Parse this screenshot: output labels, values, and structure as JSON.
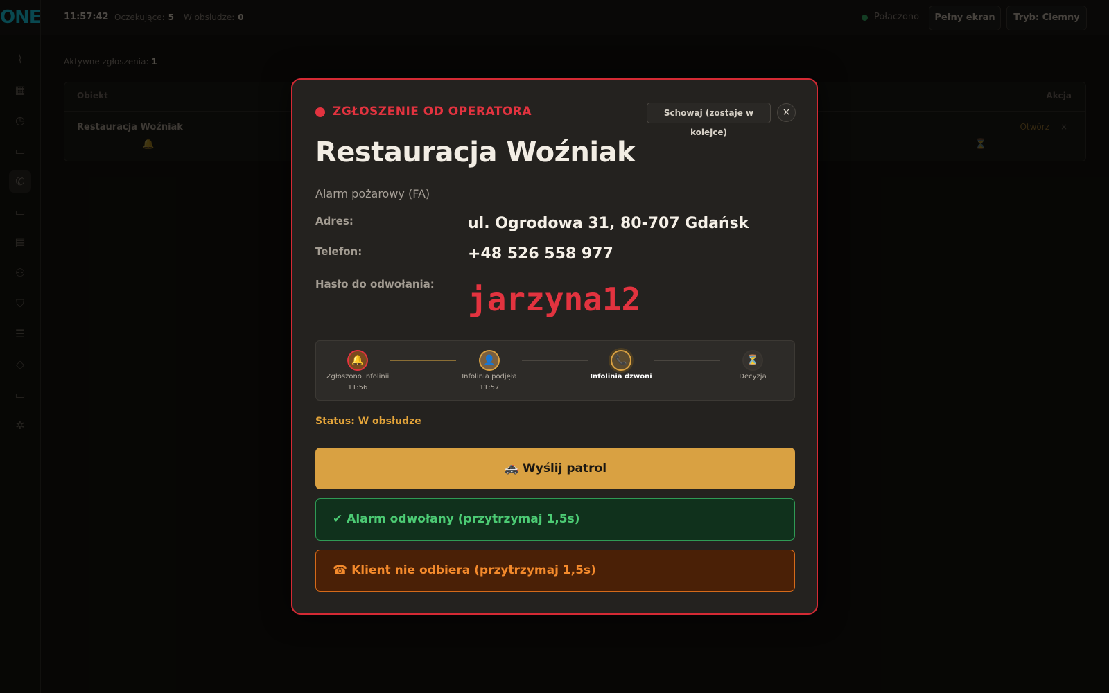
{
  "app": {
    "logo": "ONE"
  },
  "topbar": {
    "clock": "11:57:42",
    "waiting_label": "Oczekujące:",
    "waiting_count": "5",
    "in_service_label": "W obsłudze:",
    "in_service_count": "0",
    "connection": "Połączono",
    "fullscreen_button": "Pełny ekran",
    "theme_button": "Tryb: Ciemny"
  },
  "main": {
    "active_label": "Aktywne zgłoszenia:",
    "active_count": "1",
    "table": {
      "headers": {
        "object": "Obiekt",
        "action": "Akcja"
      },
      "row": {
        "name": "Restauracja Woźniak",
        "open": "Otwórz",
        "close": "×"
      }
    }
  },
  "modal": {
    "header": "ZGŁOSZENIE OD OPERATORA",
    "hide_button": "Schowaj (zostaje w kolejce)",
    "close_button": "×",
    "object_name": "Restauracja Woźniak",
    "alarm_type": "Alarm pożarowy (FA)",
    "address_label": "Adres:",
    "address": "ul. Ogrodowa 31, 80-707 Gdańsk",
    "phone_label": "Telefon:",
    "phone": "+48 526 558 977",
    "password_label": "Hasło do odwołania:",
    "password": "jarzyna12",
    "steps": [
      {
        "label": "Zgłoszono infolinii",
        "time": "11:56",
        "icon": "bell-icon",
        "glyph": "🔔"
      },
      {
        "label": "Infolinia podjęła",
        "time": "11:57",
        "icon": "person-icon",
        "glyph": "👤"
      },
      {
        "label": "Infolinia dzwoni",
        "time": "",
        "icon": "phone-icon",
        "glyph": "📞"
      },
      {
        "label": "Decyzja",
        "time": "",
        "icon": "hourglass-icon",
        "glyph": "⏳"
      }
    ],
    "status": "Status: W obsłudze",
    "patrol_button": "🚓 Wyślij patrol",
    "cancel_button": "✔ Alarm odwołany (przytrzymaj 1,5s)",
    "no_answer_button": "☎ Klient nie odbiera (przytrzymaj 1,5s)",
    "colors": {
      "accent_red": "#e2333f",
      "status_amber": "#e3a43a",
      "patrol": "#d9a142",
      "success": "#4ccb74",
      "warning": "#f48a2c"
    }
  },
  "sidebar": {
    "icons": [
      "activity-icon",
      "grid-icon",
      "timer-icon",
      "camera-icon",
      "phone-icon",
      "card-icon",
      "building-icon",
      "users-icon",
      "shield-icon",
      "server-icon",
      "tag-icon",
      "monitor-icon",
      "settings-icon"
    ]
  }
}
